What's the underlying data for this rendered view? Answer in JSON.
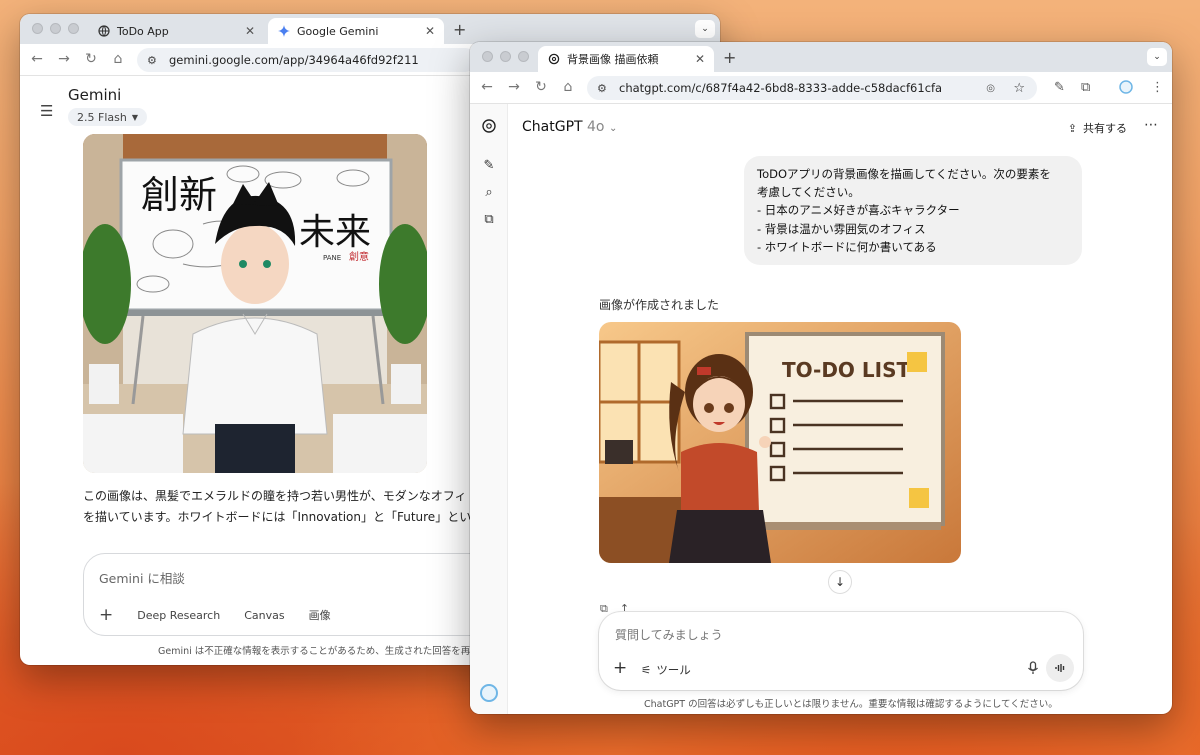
{
  "gemini_window": {
    "tabs": [
      {
        "label": "ToDo App",
        "icon": "globe-icon"
      },
      {
        "label": "Google Gemini",
        "icon": "gemini-sparkle-icon"
      }
    ],
    "url": "gemini.google.com/app/34964a46fd92f211",
    "app_title": "Gemini",
    "model_selector": "2.5 Flash",
    "image_texts": {
      "kanji_left": "創新",
      "kanji_right": "未来",
      "small_label": "PANE",
      "red_label": "創意"
    },
    "response_line1": "この画像は、黒髪でエメラルドの瞳を持つ若い男性が、モダンなオフィ",
    "response_line2": "を描いています。ホワイトボードには「Innovation」と「Future」という",
    "input_placeholder": "Gemini に相談",
    "input_tools": [
      "Deep Research",
      "Canvas",
      "画像"
    ],
    "footer": "Gemini は不正確な情報を表示することがあるため、生成された回答を再確認"
  },
  "chatgpt_window": {
    "tab": {
      "label": "背景画像 描画依頼",
      "icon": "openai-icon"
    },
    "url": "chatgpt.com/c/687f4a42-6bd8-8333-adde-c58dacf61cfa",
    "model": "ChatGPT",
    "model_version": "4o",
    "share_label": "共有する",
    "user_message": [
      "ToDOアプリの背景画像を描画してください。次の要素を",
      "考慮してください。",
      "- 日本のアニメ好きが喜ぶキャラクター",
      "- 背景は温かい雰囲気のオフィス",
      "- ホワイトボードに何か書いてある"
    ],
    "image_created": "画像が作成されました",
    "image_texts": {
      "board_title": "TO-DO LIST"
    },
    "input_placeholder": "質問してみましょう",
    "tools_label": "ツール",
    "footer": "ChatGPT の回答は必ずしも正しいとは限りません。重要な情報は確認するようにしてください。"
  }
}
